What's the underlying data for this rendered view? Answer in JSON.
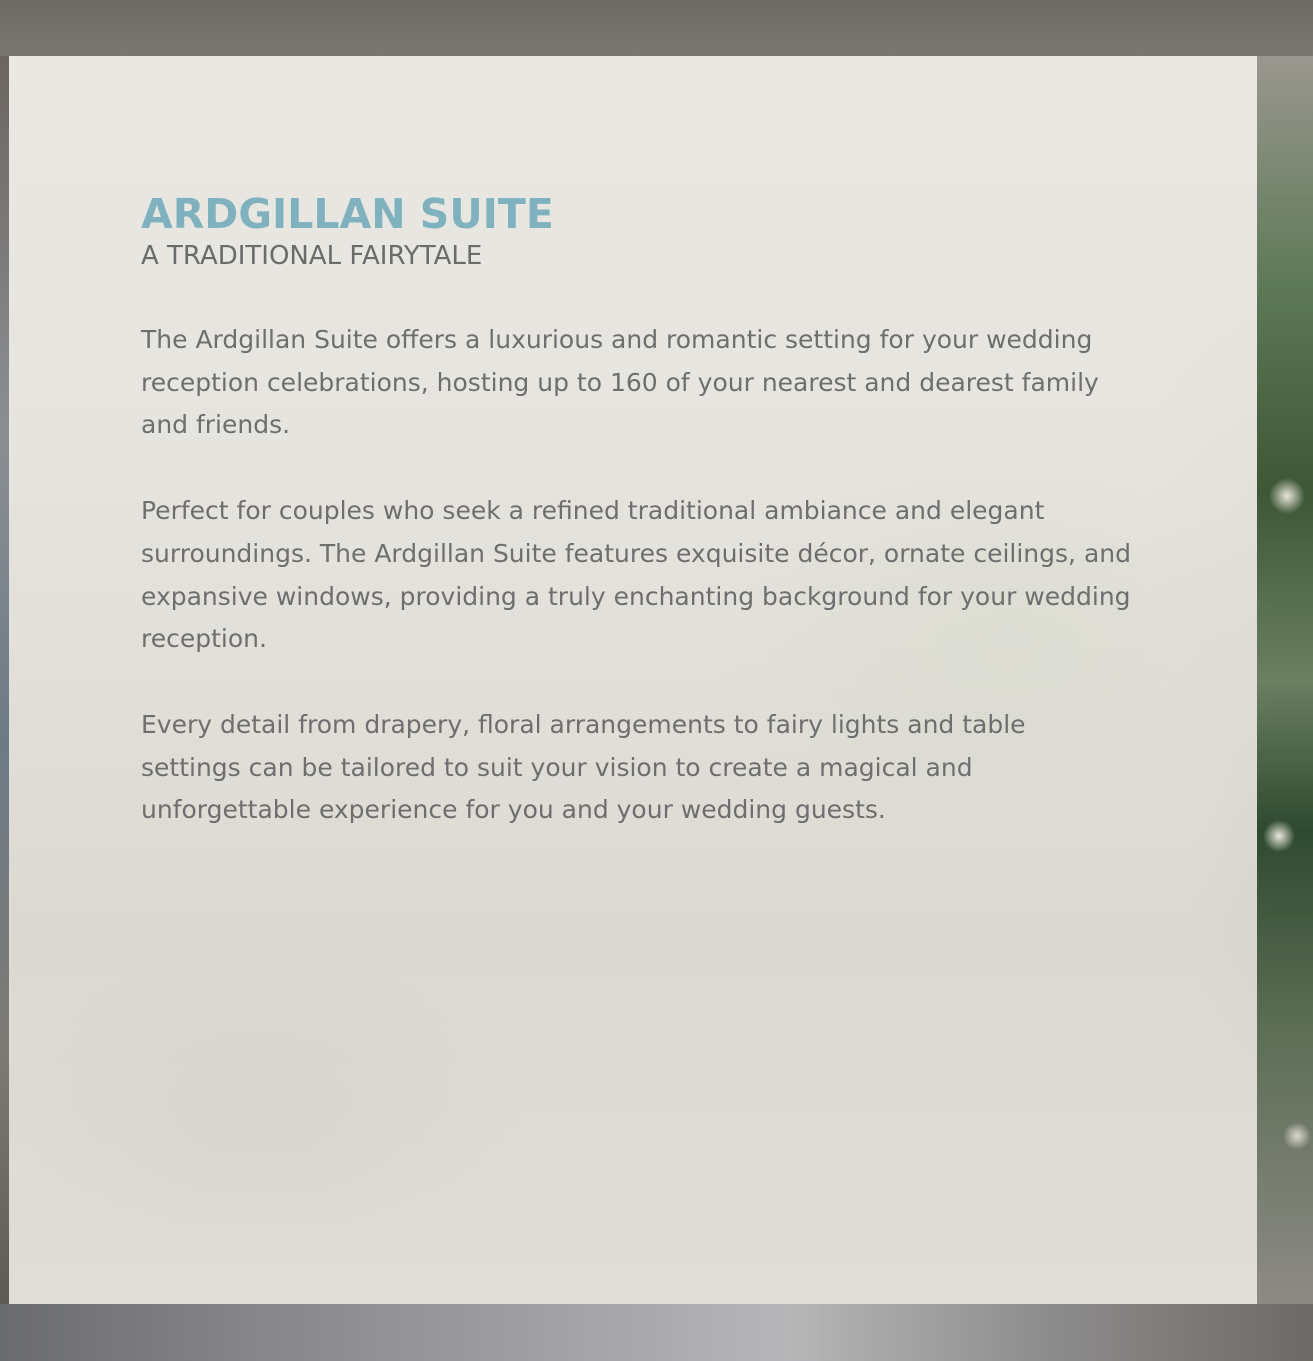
{
  "suite": {
    "title": "ARDGILLAN SUITE",
    "subtitle": "A TRADITIONAL FAIRYTALE",
    "paragraphs": [
      "The Ardgillan Suite offers a luxurious and romantic setting for your wedding reception celebrations, hosting up to 160 of your nearest and dearest family and friends.",
      "Perfect for couples who seek a refined traditional ambiance and elegant surroundings. The Ardgillan Suite features exquisite décor, ornate ceilings, and expansive windows, providing a truly enchanting background for your wedding reception.",
      "Every detail from drapery, floral arrangements to fairy lights and table settings can be tailored to suit your vision to create a magical and unforgettable experience for you and your wedding guests."
    ]
  },
  "colors": {
    "title": "#7fb2be",
    "text": "#6e6e6e",
    "panel": "#ebe9e4"
  }
}
